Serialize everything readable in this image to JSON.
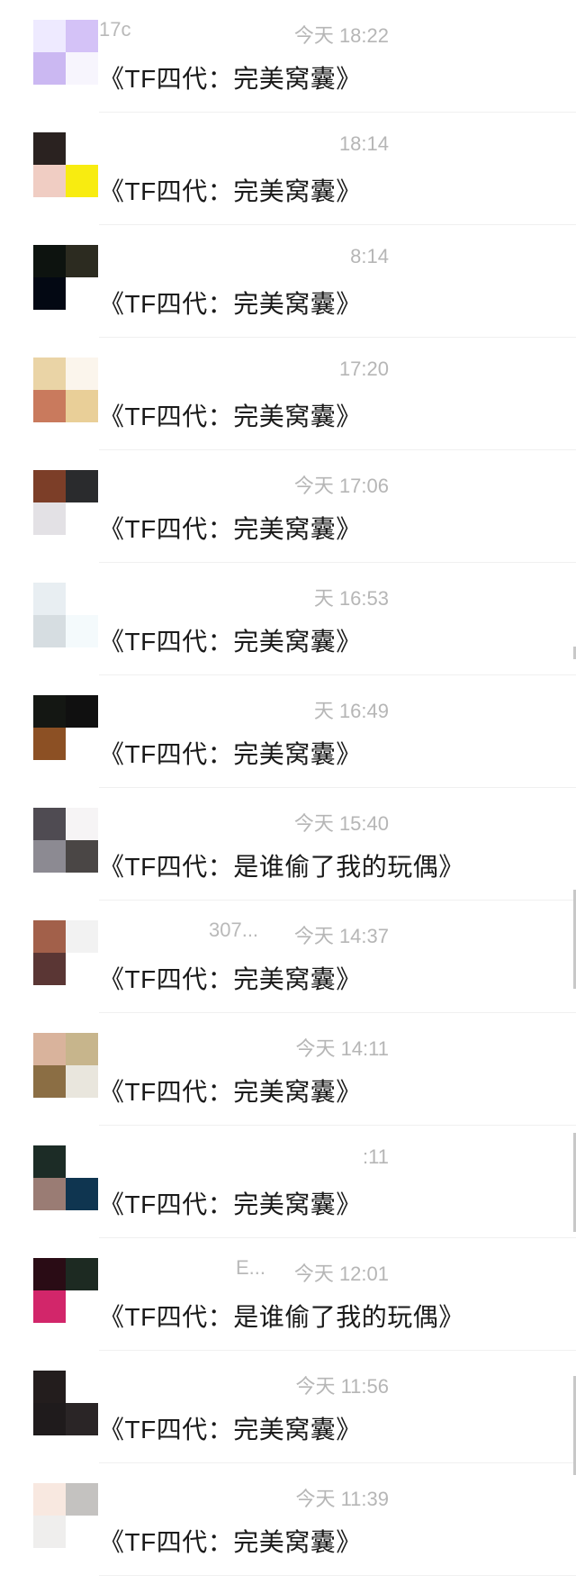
{
  "conversations": [
    {
      "nickname": "17c",
      "time": "今天 18:22",
      "message": "《TF四代：完美窝囊》",
      "avatar_colors": [
        "#eeeaff",
        "#d4c2f7",
        "#cbb8f2",
        "#f7f5fd"
      ]
    },
    {
      "nickname": "",
      "time": "18:14",
      "message": "《TF四代：完美窝囊》",
      "avatar_colors": [
        "#2a2220",
        "#ffffff",
        "#f0cdc3",
        "#f8ec10"
      ]
    },
    {
      "nickname": "",
      "time": "8:14",
      "message": "《TF四代：完美窝囊》",
      "avatar_colors": [
        "#0d130f",
        "#2c2b20",
        "#030813",
        "#ffffff"
      ]
    },
    {
      "nickname": "",
      "time": "17:20",
      "message": "《TF四代：完美窝囊》",
      "avatar_colors": [
        "#ead4a6",
        "#fbf5ec",
        "#c97a5d",
        "#e9cf98"
      ]
    },
    {
      "nickname": "",
      "time": "今天 17:06",
      "message": "《TF四代：完美窝囊》",
      "avatar_colors": [
        "#7c3e28",
        "#2a2b2d",
        "#e3e1e5",
        "#ffffff"
      ]
    },
    {
      "nickname": "",
      "time": "天 16:53",
      "message": "《TF四代：完美窝囊》",
      "avatar_colors": [
        "#e8eef2",
        "#ffffff",
        "#d6dde1",
        "#f4fafc"
      ]
    },
    {
      "nickname": "",
      "time": "天 16:49",
      "message": "《TF四代：完美窝囊》",
      "avatar_colors": [
        "#141713",
        "#101010",
        "#8c5024",
        "#ffffff"
      ]
    },
    {
      "nickname": "",
      "time": "今天 15:40",
      "message": "《TF四代：是谁偷了我的玩偶》",
      "avatar_colors": [
        "#4f4b52",
        "#f6f4f5",
        "#8c8a92",
        "#4a4645"
      ]
    },
    {
      "nickname": "307...",
      "time": "今天 14:37",
      "message": "《TF四代：完美窝囊》",
      "avatar_colors": [
        "#a2604a",
        "#f2f2f2",
        "#5a3634",
        "#ffffff"
      ]
    },
    {
      "nickname": "",
      "time": "今天 14:11",
      "message": "《TF四代：完美窝囊》",
      "avatar_colors": [
        "#d9b39c",
        "#c7b58c",
        "#8b6e44",
        "#e9e6dd"
      ]
    },
    {
      "nickname": "",
      "time": ":11",
      "message": "《TF四代：完美窝囊》",
      "avatar_colors": [
        "#1c2c26",
        "#ffffff",
        "#9a7c74",
        "#0f3550"
      ]
    },
    {
      "nickname": "E...",
      "time": "今天 12:01",
      "message": "《TF四代：是谁偷了我的玩偶》",
      "avatar_colors": [
        "#2a0c15",
        "#1d2a22",
        "#d2266a",
        "#ffffff"
      ]
    },
    {
      "nickname": "",
      "time": "今天 11:56",
      "message": "《TF四代：完美窝囊》",
      "avatar_colors": [
        "#231d1d",
        "#ffffff",
        "#1f1b1c",
        "#2a2526"
      ]
    },
    {
      "nickname": "",
      "time": "今天 11:39",
      "message": "《TF四代：完美窝囊》",
      "avatar_colors": [
        "#f8e8e0",
        "#c4c2c0",
        "#efeeed",
        "#ffffff"
      ]
    }
  ]
}
